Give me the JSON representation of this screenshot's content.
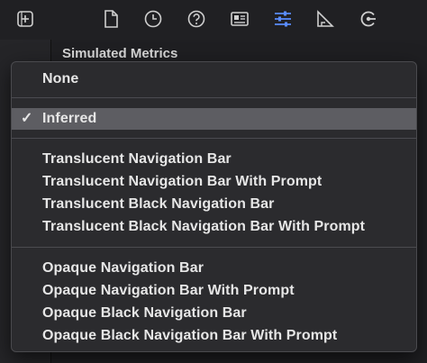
{
  "toolbar": {
    "icons": [
      {
        "name": "library-icon"
      },
      {
        "name": "file-icon"
      },
      {
        "name": "history-icon"
      },
      {
        "name": "help-icon"
      },
      {
        "name": "identity-icon"
      },
      {
        "name": "attributes-icon"
      },
      {
        "name": "size-icon"
      },
      {
        "name": "connections-icon"
      }
    ],
    "active_color": "#5a8cff"
  },
  "inspector": {
    "section_title": "Simulated Metrics"
  },
  "menu": {
    "selected_index": 1,
    "items": [
      {
        "label": "None"
      },
      {
        "label": "Inferred"
      },
      {
        "label": "Translucent Navigation Bar"
      },
      {
        "label": "Translucent Navigation Bar With Prompt"
      },
      {
        "label": "Translucent Black Navigation Bar"
      },
      {
        "label": "Translucent Black Navigation Bar With Prompt"
      },
      {
        "label": "Opaque Navigation Bar"
      },
      {
        "label": "Opaque Navigation Bar With Prompt"
      },
      {
        "label": "Opaque Black Navigation Bar"
      },
      {
        "label": "Opaque Black Navigation Bar With Prompt"
      }
    ],
    "check_glyph": "✓"
  }
}
